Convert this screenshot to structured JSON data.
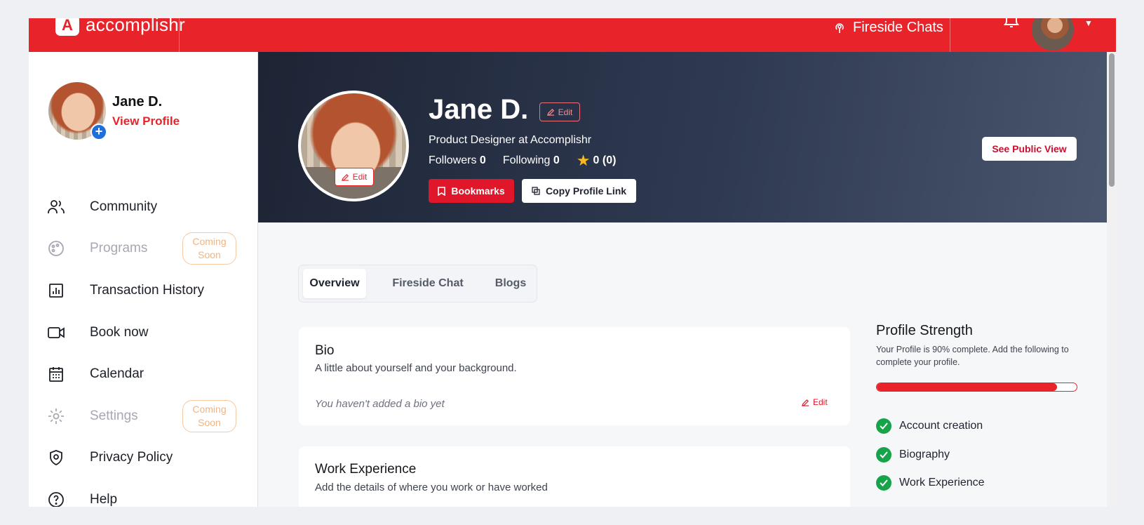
{
  "brand": {
    "logo_text": "accomplishr",
    "accent": "#e8242a"
  },
  "topbar": {
    "fireside_label": "Fireside Chats",
    "icons": [
      "podcast-icon",
      "bell-icon",
      "chevron-down-icon"
    ]
  },
  "sidebar": {
    "user_name": "Jane D.",
    "view_profile": "View Profile",
    "items": [
      {
        "label": "Community",
        "icon": "users-icon",
        "disabled": false
      },
      {
        "label": "Programs",
        "icon": "palette-icon",
        "disabled": true,
        "badge": "Coming Soon"
      },
      {
        "label": "Transaction History",
        "icon": "chart-icon",
        "disabled": false
      },
      {
        "label": "Book now",
        "icon": "video-icon",
        "disabled": false
      },
      {
        "label": "Calendar",
        "icon": "calendar-icon",
        "disabled": false
      },
      {
        "label": "Settings",
        "icon": "gear-icon",
        "disabled": true,
        "badge": "Coming Soon"
      },
      {
        "label": "Privacy Policy",
        "icon": "shield-icon",
        "disabled": false
      },
      {
        "label": "Help",
        "icon": "help-icon",
        "disabled": false
      }
    ]
  },
  "hero": {
    "name": "Jane D.",
    "edit_label": "Edit",
    "avatar_edit_label": "Edit",
    "title": "Product Designer at Accomplishr",
    "followers_label": "Followers",
    "followers": "0",
    "following_label": "Following",
    "following": "0",
    "rating": "0 (0)",
    "bookmarks_label": "Bookmarks",
    "copy_link_label": "Copy Profile Link",
    "public_view_label": "See Public View"
  },
  "tabs": [
    {
      "label": "Overview",
      "active": true
    },
    {
      "label": "Fireside Chat",
      "active": false
    },
    {
      "label": "Blogs",
      "active": false
    }
  ],
  "bio": {
    "title": "Bio",
    "subtitle": "A little about yourself and your background.",
    "empty": "You haven't added a bio yet",
    "edit_label": "Edit"
  },
  "work": {
    "title": "Work Experience",
    "subtitle": "Add the details of where you work or have worked"
  },
  "strength": {
    "title": "Profile Strength",
    "desc": "Your Profile is 90% complete. Add the following to complete your profile.",
    "percent": 90,
    "items": [
      "Account creation",
      "Biography",
      "Work Experience"
    ]
  }
}
